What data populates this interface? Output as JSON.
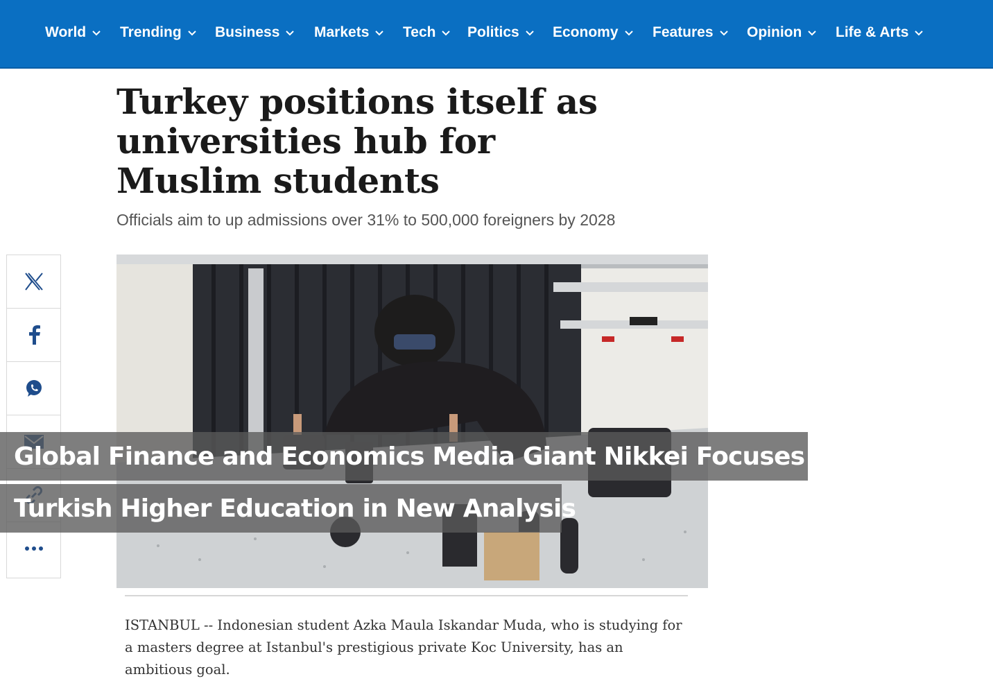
{
  "nav": {
    "items": [
      {
        "label": "World"
      },
      {
        "label": "Trending"
      },
      {
        "label": "Business"
      },
      {
        "label": "Markets"
      },
      {
        "label": "Tech"
      },
      {
        "label": "Politics"
      },
      {
        "label": "Economy"
      },
      {
        "label": "Features"
      },
      {
        "label": "Opinion"
      },
      {
        "label": "Life & Arts"
      }
    ],
    "background": "#0a6fc2"
  },
  "article": {
    "headline": "Turkey positions itself as universities hub for Muslim students",
    "subheadline": "Officials aim to up admissions over 31% to 500,000 foreigners by 2028",
    "dateline_text": "ISTANBUL -- Indonesian student Azka Maula Iskandar Muda, who is studying for a masters degree at Istanbul's prestigious private Koc University, has an ambitious goal."
  },
  "share": {
    "icons": [
      "x-icon",
      "facebook-icon",
      "whatsapp-icon",
      "email-icon",
      "link-icon",
      "more-icon"
    ]
  },
  "overlay": {
    "line1": "Global Finance and Economics Media Giant Nikkei Focuses on",
    "line2": "Turkish Higher Education in New Analysis"
  }
}
